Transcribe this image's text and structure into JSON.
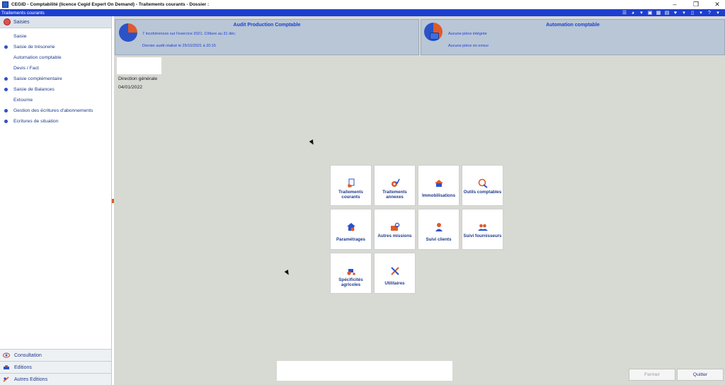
{
  "window": {
    "title": "CEGID - Comptabilité (licence Cegid Expert On Demand) - Traitements courants - Dossier :",
    "controls": {
      "minimize": "–",
      "restore": "❐",
      "close": "✕"
    }
  },
  "bluebar": {
    "title": "Traitements courants",
    "icons": [
      "list-icon",
      "palette-icon",
      "dropdown-icon",
      "calendar-icon",
      "grid-icon",
      "table-icon",
      "heart-icon",
      "dropdown-icon",
      "document-icon",
      "dropdown-icon",
      "help-icon",
      "dropdown-icon"
    ]
  },
  "sidebar": {
    "header": "Saisies",
    "items": [
      {
        "label": "Saisie",
        "bullet": false
      },
      {
        "label": "Saisie de trésorerie",
        "bullet": true
      },
      {
        "label": "Automation comptable",
        "bullet": false
      },
      {
        "label": "Devis / Fact",
        "bullet": false
      },
      {
        "label": "Saisie complémentaire",
        "bullet": true
      },
      {
        "label": "Saisie de Balances",
        "bullet": true
      },
      {
        "label": "Extourne",
        "bullet": false
      },
      {
        "label": "Gestion des écritures d'abonnements",
        "bullet": true
      },
      {
        "label": "Ecritures de situation",
        "bullet": true
      }
    ],
    "footer": [
      {
        "label": "Consultation",
        "icon": "eye-icon"
      },
      {
        "label": "Editions",
        "icon": "printer-icon"
      },
      {
        "label": "Autres Editions",
        "icon": "tools-icon"
      }
    ]
  },
  "panels": {
    "audit": {
      "title": "Audit Production Comptable",
      "line1": "7 incohérences sur l'exercice 2021. Clôture au 31 déc.",
      "line2": "Dernier audit réalisé le 25/10/2021 à 20:15"
    },
    "automation": {
      "title": "Automation comptable",
      "line1": "Aucune pièce intégrée",
      "line2": "Aucune pièce en erreur"
    }
  },
  "direction": {
    "title": "Direction générale",
    "date": "04/01/2022"
  },
  "tiles": [
    {
      "id": "traitements-courants",
      "label": "Traitements courants",
      "icon": "document-hand-icon"
    },
    {
      "id": "traitements-annexes",
      "label": "Traitements annexes",
      "icon": "gear-check-icon"
    },
    {
      "id": "immobilisations",
      "label": "Immobilisations",
      "icon": "house-icon"
    },
    {
      "id": "outils-comptables",
      "label": "Outils comptables",
      "icon": "euro-wrench-icon"
    },
    {
      "id": "parametrages",
      "label": "Paramétrages",
      "icon": "settings-house-icon"
    },
    {
      "id": "autres-missions",
      "label": "Autres missions",
      "icon": "briefcase-search-icon"
    },
    {
      "id": "suivi-clients",
      "label": "Suivi clients",
      "icon": "person-icon"
    },
    {
      "id": "suivi-fournisseurs",
      "label": "Suivi fournisseurs",
      "icon": "people-icon"
    },
    {
      "id": "specificites-agricoles",
      "label": "Spécificités agricoles",
      "icon": "tractor-icon"
    },
    {
      "id": "utilitaires",
      "label": "Utilitaires",
      "icon": "tools-icon"
    }
  ],
  "buttons": {
    "fermer": "Fermer",
    "quitter": "Quitter"
  },
  "colors": {
    "accent_blue": "#1d3fd0",
    "accent_orange": "#e05a2a",
    "panel_bg": "#b8c6d6",
    "workspace_bg": "#d7d9d3"
  }
}
